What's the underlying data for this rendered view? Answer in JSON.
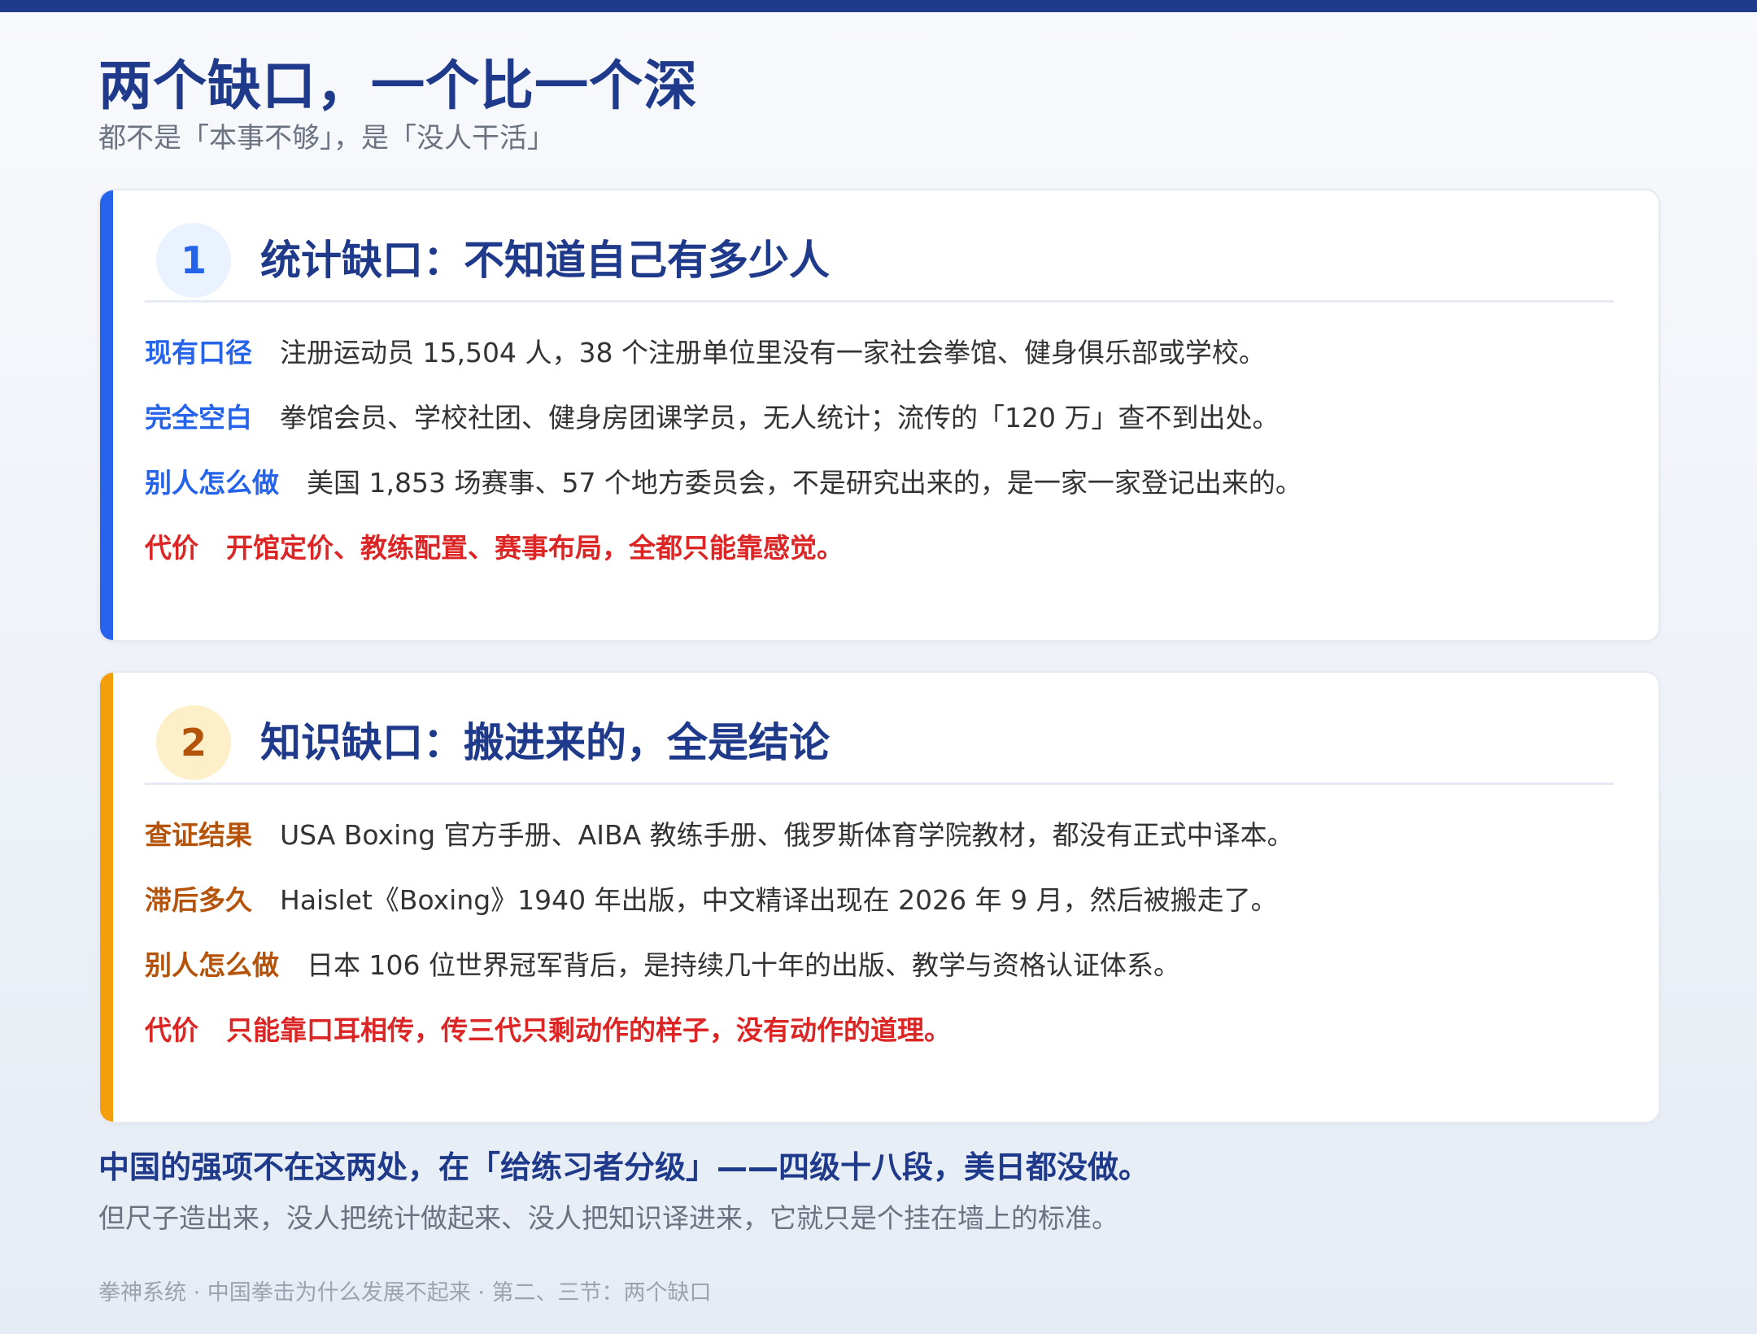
{
  "header": {
    "title": "两个缺口，一个比一个深",
    "subtitle": "都不是「本事不够」，是「没人干活」"
  },
  "cards": [
    {
      "number": "1",
      "title": "统计缺口：不知道自己有多少人",
      "accent_color": "#2563eb",
      "rows": [
        {
          "label": "现有口径",
          "text": "注册运动员 15,504 人，38 个注册单位里没有一家社会拳馆、健身俱乐部或学校。"
        },
        {
          "label": "完全空白",
          "text": "拳馆会员、学校社团、健身房团课学员，无人统计；流传的「120 万」查不到出处。"
        },
        {
          "label": "别人怎么做",
          "text": "美国 1,853 场赛事、57 个地方委员会，不是研究出来的，是一家一家登记出来的。"
        },
        {
          "label": "代价",
          "text": "开馆定价、教练配置、赛事布局，全都只能靠感觉。"
        }
      ]
    },
    {
      "number": "2",
      "title": "知识缺口：搬进来的，全是结论",
      "accent_color": "#f59e0b",
      "rows": [
        {
          "label": "查证结果",
          "text": "USA Boxing 官方手册、AIBA 教练手册、俄罗斯体育学院教材，都没有正式中译本。"
        },
        {
          "label": "滞后多久",
          "text": "Haislet《Boxing》1940 年出版，中文精译出现在 2026 年 9 月，然后被搬走了。"
        },
        {
          "label": "别人怎么做",
          "text": "日本 106 位世界冠军背后，是持续几十年的出版、教学与资格认证体系。"
        },
        {
          "label": "代价",
          "text": "只能靠口耳相传，传三代只剩动作的样子，没有动作的道理。"
        }
      ]
    }
  ],
  "conclusion": {
    "main": "中国的强项不在这两处，在「给练习者分级」——四级十八段，美日都没做。",
    "sub": "但尺子造出来，没人把统计做起来、没人把知识译进来，它就只是个挂在墙上的标准。"
  },
  "footer": "拳神系统 · 中国拳击为什么发展不起来 · 第二、三节：两个缺口"
}
